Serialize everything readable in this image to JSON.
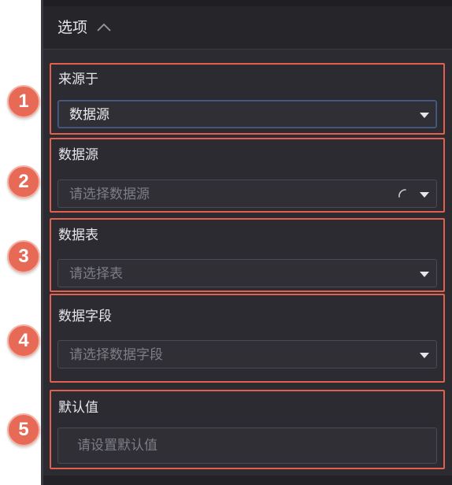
{
  "header": {
    "title": "选项",
    "collapse_icon": "chevron-up-icon"
  },
  "fields": [
    {
      "badge": "1",
      "label": "来源于",
      "value": "数据源",
      "placeholder": ""
    },
    {
      "badge": "2",
      "label": "数据源",
      "value": "",
      "placeholder": "请选择数据源",
      "loading": true
    },
    {
      "badge": "3",
      "label": "数据表",
      "value": "",
      "placeholder": "请选择表"
    },
    {
      "badge": "4",
      "label": "数据字段",
      "value": "",
      "placeholder": "请选择数据字段"
    },
    {
      "badge": "5",
      "label": "默认值",
      "value": "",
      "placeholder": "请设置默认值"
    }
  ],
  "colors": {
    "panel_bg": "#2b2b31",
    "highlight_border": "#e2604c",
    "badge_fill": "#e66a56"
  }
}
